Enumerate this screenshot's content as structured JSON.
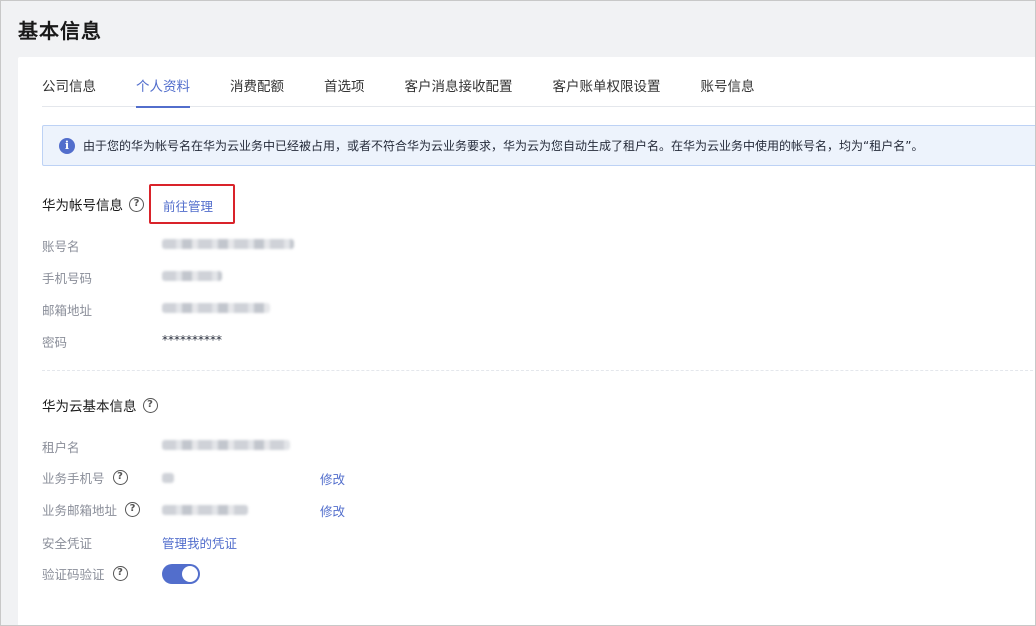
{
  "page_title": "基本信息",
  "tabs": [
    {
      "label": "公司信息",
      "active": false
    },
    {
      "label": "个人资料",
      "active": true
    },
    {
      "label": "消费配额",
      "active": false
    },
    {
      "label": "首选项",
      "active": false
    },
    {
      "label": "客户消息接收配置",
      "active": false
    },
    {
      "label": "客户账单权限设置",
      "active": false
    },
    {
      "label": "账号信息",
      "active": false
    }
  ],
  "banner": {
    "icon": "info-icon",
    "text": "由于您的华为帐号名在华为云业务中已经被占用，或者不符合华为云业务要求，华为云为您自动生成了租户名。在华为云业务中使用的帐号名，均为“租户名”。"
  },
  "huawei_account": {
    "title": "华为帐号信息",
    "manage_link": "前往管理",
    "rows": [
      {
        "label": "账号名"
      },
      {
        "label": "手机号码"
      },
      {
        "label": "邮箱地址"
      },
      {
        "label": "密码",
        "value": "**********"
      }
    ]
  },
  "cloud_basic": {
    "title": "华为云基本信息",
    "rows": [
      {
        "label": "租户名"
      },
      {
        "label": "业务手机号",
        "action": "修改"
      },
      {
        "label": "业务邮箱地址",
        "action": "修改"
      },
      {
        "label": "安全凭证",
        "link": "管理我的凭证"
      },
      {
        "label": "验证码验证",
        "toggle": true
      }
    ]
  },
  "colors": {
    "accent": "#526ecc",
    "highlight_border": "#d9232a",
    "banner_bg": "#edf3fc"
  }
}
